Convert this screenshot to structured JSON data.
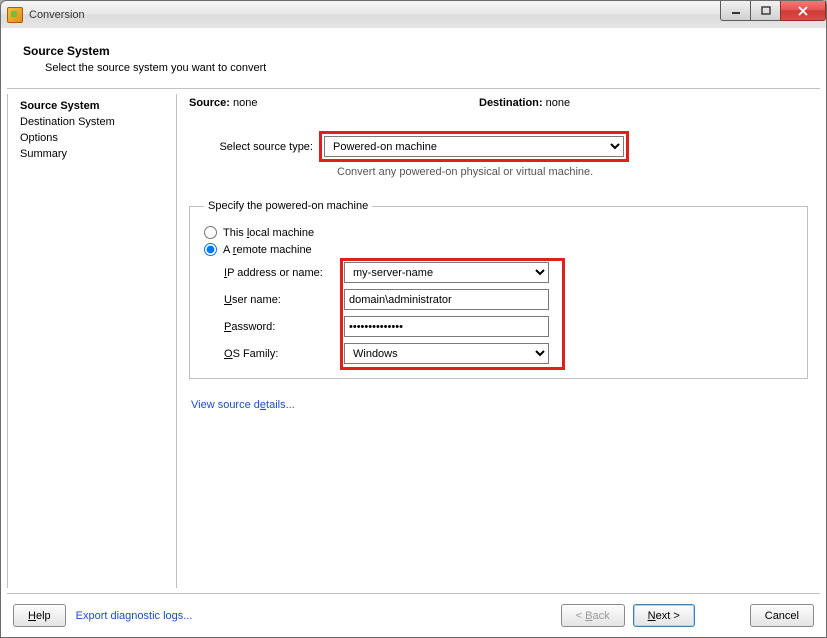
{
  "window": {
    "title": "Conversion"
  },
  "header": {
    "title": "Source System",
    "subtitle": "Select the source system you want to convert"
  },
  "sidebar": {
    "items": [
      {
        "label": "Source System",
        "active": true
      },
      {
        "label": "Destination System",
        "active": false
      },
      {
        "label": "Options",
        "active": false
      },
      {
        "label": "Summary",
        "active": false
      }
    ]
  },
  "main": {
    "source_label": "Source:",
    "source_value": "none",
    "dest_label": "Destination:",
    "dest_value": "none",
    "select_source_label": "Select source type:",
    "select_source_value": "Powered-on machine",
    "select_source_hint": "Convert any powered-on physical or virtual machine.",
    "fieldset_legend": "Specify the powered-on machine",
    "radio_local": "This local machine",
    "radio_remote": "A remote machine",
    "radio_selected": "remote",
    "fields": {
      "ip_label": "IP address or name:",
      "ip_value": "my-server-name",
      "user_label": "User name:",
      "user_value": "domain\\administrator",
      "password_label": "Password:",
      "password_value": "••••••••••••••",
      "os_label": "OS Family:",
      "os_value": "Windows"
    },
    "view_details": "View source details..."
  },
  "footer": {
    "help": "Help",
    "export_logs": "Export diagnostic logs...",
    "back": "< Back",
    "next": "Next >",
    "cancel": "Cancel"
  }
}
